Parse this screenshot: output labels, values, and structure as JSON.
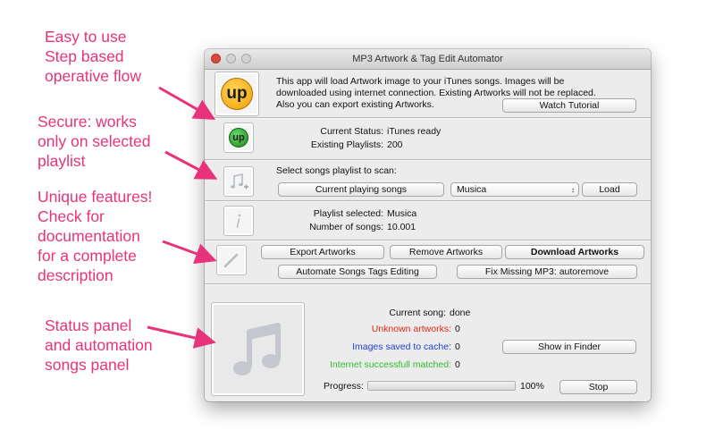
{
  "callouts": {
    "c1": "Easy to use\nStep based\noperative flow",
    "c2": "Secure: works\nonly on selected\nplaylist",
    "c3": "Unique features!\nCheck for\ndocumentation\nfor a complete\ndescription",
    "c4": "Status panel\nand automation\nsongs panel"
  },
  "colors": {
    "callout": "#e8337a",
    "unknown": "#e8251c",
    "cache": "#1f3fd8",
    "matched": "#2fbf2f"
  },
  "window": {
    "title": "MP3 Artwork & Tag Edit Automator"
  },
  "intro": {
    "logo_text": "up",
    "line1": "This  app  will  load  Artwork  image  to  your  iTunes  songs.  Images  will  be",
    "line2": "downloaded  using internet connection. Existing Artworks will not be replaced.",
    "line3": "Also you can export existing Artworks.",
    "watch_tutorial": "Watch Tutorial"
  },
  "status": {
    "icon_text": "up",
    "current_status_label": "Current Status:",
    "current_status_value": "iTunes ready",
    "existing_playlists_label": "Existing Playlists:",
    "existing_playlists_value": "200"
  },
  "scan": {
    "icon": "music-note-add-icon",
    "prompt": "Select songs playlist to scan:",
    "current_playing": "Current playing songs",
    "playlist_value": "Musica",
    "load": "Load"
  },
  "playlist": {
    "icon": "info-icon",
    "selected_label": "Playlist selected:",
    "selected_value": "Musica",
    "songs_label": "Number of songs:",
    "songs_value": "10.001"
  },
  "actions": {
    "icon": "pencil-icon",
    "export": "Export Artworks",
    "remove": "Remove Artworks",
    "download": "Download Artworks",
    "automate": "Automate Songs Tags Editing",
    "fix": "Fix Missing MP3: autoremove"
  },
  "panel": {
    "artwork_icon": "music-note-icon",
    "current_song_label": "Current song:",
    "current_song_value": "done",
    "unknown_label": "Unknown artworks:",
    "unknown_value": "0",
    "cache_label": "Images saved to cache:",
    "cache_value": "0",
    "matched_label": "Internet successfull matched:",
    "matched_value": "0",
    "show_in_finder": "Show in Finder",
    "progress_label": "Progress:",
    "progress_value": 1.0,
    "progress_text": "100%",
    "stop": "Stop"
  }
}
